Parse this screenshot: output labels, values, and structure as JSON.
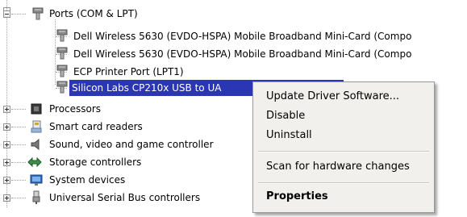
{
  "tree": {
    "ports": {
      "label": "Ports (COM & LPT)",
      "children": [
        "Dell Wireless 5630 (EVDO-HSPA) Mobile Broadband Mini-Card (Compo",
        "Dell Wireless 5630 (EVDO-HSPA) Mobile Broadband Mini-Card (Compo",
        "ECP Printer Port (LPT1)",
        "Silicon Labs CP210x USB to UA"
      ]
    },
    "categories": [
      "Processors",
      "Smart card readers",
      "Sound, video and game controller",
      "Storage controllers",
      "System devices",
      "Universal Serial Bus controllers"
    ]
  },
  "context_menu": {
    "items": [
      "Update Driver Software...",
      "Disable",
      "Uninstall",
      "Scan for hardware changes",
      "Properties"
    ]
  },
  "colors": {
    "selection": "#2a36b3",
    "menu_bg": "#f1f0ec"
  },
  "icons": {
    "port": "port-connector-icon",
    "processor": "processor-chip-icon",
    "smartcard": "smart-card-reader-icon",
    "sound": "speaker-icon",
    "storage": "storage-controller-icon",
    "system": "system-devices-icon",
    "usb": "usb-plug-icon"
  }
}
